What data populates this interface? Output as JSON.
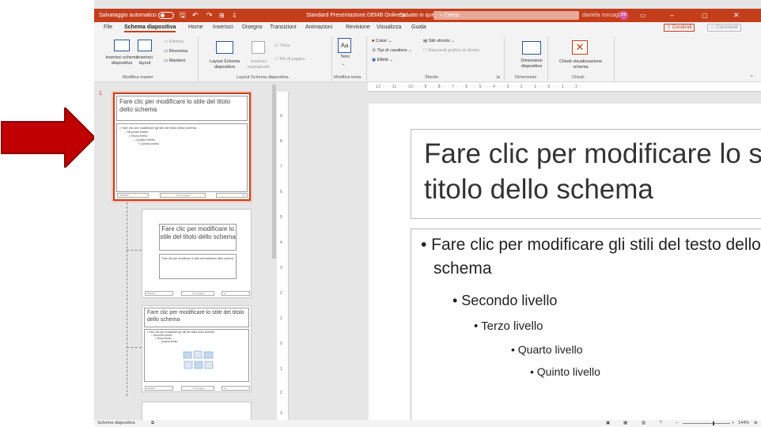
{
  "title_bar": {
    "autosave_label": "Salvataggio automatico",
    "autosave_state": "off",
    "document_title": "Standard Presentazione DEMB Online.p...",
    "save_status": "Salvato in questo PC",
    "search_placeholder": "Cerca",
    "user_name": "daniela roncaglia",
    "user_initials": "DR"
  },
  "tabs": [
    "File",
    "Schema diapositiva",
    "Home",
    "Inserisci",
    "Disegno",
    "Transizioni",
    "Animazioni",
    "Revisione",
    "Visualizza",
    "Guida"
  ],
  "share_label": "Condividi",
  "comments_label": "Commenti",
  "ribbon": {
    "insert_master": "Inserisci schema\ndiapositiva",
    "insert_layout": "Inserisci\nlayout",
    "delete": "Elimina",
    "rename": "Rinomina",
    "preserve": "Mantieni",
    "master_layout": "Layout Schema\ndiapositiva",
    "insert_placeholder": "Inserisci\nsegnaposto",
    "title_check": "Titolo",
    "footer_check": "Piè di pagina",
    "themes": "Temi",
    "colors": "Colori",
    "fonts": "Tipi di carattere",
    "effects": "Effetti",
    "bg_styles": "Stili sfondo",
    "hide_bg": "Nascondi grafica di sfondo",
    "slide_size": "Dimensioni\ndiapositiva",
    "close_view": "Chiudi visualizzazione\nschema",
    "groups": {
      "edit_master": "Modifica master",
      "master_layout": "Layout Schema diapositiva",
      "edit_theme": "Modifica tema",
      "background": "Sfondo",
      "size": "Dimensioni",
      "close": "Chiudi"
    }
  },
  "ruler_text": "12 · · · 11 · · · 10 · · · 9 · · · 8 · · · 7 · · · 6 · · · 5 · · · 4 · · · 3 · · · 2 · · · 1 · · · 0 · · · 1 · · · 2 ·",
  "vertical_ruler": [
    "9",
    "8",
    "7",
    "6",
    "5",
    "4",
    "3",
    "2",
    "1",
    "0",
    "1",
    "2",
    "3"
  ],
  "thumbnails": {
    "slide_number": "1",
    "master_title": "Fare clic per modificare lo stile del titolo dello schema",
    "master_body_l1": "• Fare clic per modificare gli stili del testo dello schema",
    "master_body_l2": "– Secondo livello",
    "master_body_l3": "• Terzo livello",
    "master_body_l4": "– Quarto livello",
    "master_body_l5": "» Quinto livello",
    "layout1_title": "Fare clic per modificare lo stile del titolo dello schema",
    "layout1_subtitle": "Fare clic per modificare lo stile del sottotitolo dello schema",
    "layout2_title": "Fare clic per modificare lo stile del titolo dello schema",
    "layout2_body": "• Fare clic per modificare gli stili del testo dello schema",
    "footer_date": "00/00/00",
    "footer_text": "Piè di pagina",
    "footer_num": "‹#›"
  },
  "slide": {
    "title_line1": "Fare clic per modificare lo stile del",
    "title_line2": "titolo dello schema",
    "body_l1a": "• Fare clic per modificare gli stili del testo dello",
    "body_l1b": "schema",
    "body_l2": "• Secondo livello",
    "body_l3": "• Terzo livello",
    "body_l4": "• Quarto livello",
    "body_l5": "• Quinto livello"
  },
  "status_bar": {
    "view_label": "Schema diapositiva",
    "zoom": "144%"
  },
  "colors": {
    "accent": "#c43e1c",
    "arrow": "#c00000"
  }
}
